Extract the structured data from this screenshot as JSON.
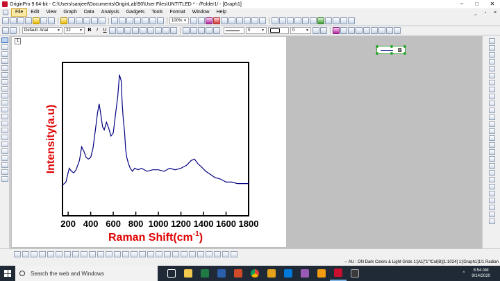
{
  "window": {
    "title": "OriginPro 9 64-bit - C:\\Users\\sanjeet\\Documents\\OriginLab\\90\\User Files\\UNTITLED * - /Folder1/ - [Graph1]",
    "min": "–",
    "max": "□",
    "close": "✕"
  },
  "menu": [
    "File",
    "Edit",
    "View",
    "Graph",
    "Data",
    "Analysis",
    "Gadgets",
    "Tools",
    "Format",
    "Window",
    "Help"
  ],
  "mdi_controls": [
    "_",
    "▫",
    "×"
  ],
  "toolbar": {
    "zoom": "100%",
    "font_name": "Default: Arial",
    "font_size": "22",
    "bold": "B",
    "italic": "I",
    "underline": "U",
    "line_width": "0",
    "fill_width": "0"
  },
  "graph": {
    "layer_number": "1",
    "legend_label": "B"
  },
  "chart_data": {
    "type": "line",
    "xlabel": "Raman Shift(cm",
    "xlabel_sup": "-1",
    "xlabel_end": ")",
    "ylabel": "Intensity(a.u)",
    "xlim": [
      150,
      1800
    ],
    "ylim": [
      0,
      1
    ],
    "xticks": [
      200,
      400,
      600,
      800,
      1000,
      1200,
      1400,
      1600,
      1800
    ],
    "legend": [
      "B"
    ],
    "line_color": "#000080",
    "label_color": "#e00000",
    "series": [
      {
        "name": "B",
        "x": [
          150,
          180,
          210,
          230,
          250,
          270,
          300,
          320,
          340,
          360,
          380,
          400,
          420,
          440,
          460,
          475,
          490,
          505,
          520,
          540,
          560,
          580,
          600,
          620,
          640,
          655,
          670,
          680,
          690,
          700,
          710,
          720,
          735,
          750,
          770,
          790,
          820,
          850,
          900,
          950,
          1000,
          1050,
          1100,
          1150,
          1200,
          1250,
          1290,
          1320,
          1350,
          1380,
          1420,
          1460,
          1500,
          1550,
          1600,
          1650,
          1700,
          1750,
          1800
        ],
        "y": [
          0.2,
          0.22,
          0.31,
          0.29,
          0.28,
          0.3,
          0.36,
          0.45,
          0.42,
          0.38,
          0.37,
          0.38,
          0.44,
          0.55,
          0.67,
          0.73,
          0.66,
          0.58,
          0.56,
          0.61,
          0.57,
          0.52,
          0.54,
          0.66,
          0.78,
          0.92,
          0.88,
          0.72,
          0.62,
          0.55,
          0.43,
          0.38,
          0.34,
          0.31,
          0.29,
          0.31,
          0.3,
          0.31,
          0.29,
          0.3,
          0.3,
          0.29,
          0.31,
          0.3,
          0.31,
          0.33,
          0.36,
          0.37,
          0.34,
          0.32,
          0.29,
          0.27,
          0.25,
          0.24,
          0.22,
          0.22,
          0.21,
          0.21,
          0.21
        ]
      }
    ]
  },
  "status": "-- AU : ON  Dark Colors & Light Grids  1:[A1]\"1\"!Col(B)[1:1024]  1:[Graph1]1!1  Radian",
  "taskbar": {
    "search_placeholder": "Search the web and Windows",
    "time": "8:54 AM",
    "date": "9/14/2020"
  }
}
